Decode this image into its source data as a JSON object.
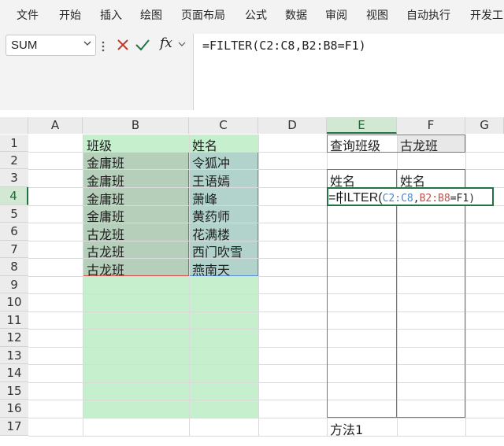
{
  "ribbon": {
    "tabs": [
      "文件",
      "开始",
      "插入",
      "绘图",
      "页面布局",
      "公式",
      "数据",
      "审阅",
      "视图",
      "自动执行",
      "开发工"
    ]
  },
  "formula_bar": {
    "name_box": "SUM",
    "fx_label": "fx",
    "formula": "=FILTER(C2:C8,B2:B8=F1)"
  },
  "columns": [
    "A",
    "B",
    "C",
    "D",
    "E",
    "F",
    "G"
  ],
  "rows": [
    "1",
    "2",
    "3",
    "4",
    "5",
    "6",
    "7",
    "8",
    "9",
    "10",
    "11",
    "12",
    "13",
    "14",
    "15",
    "16",
    "17"
  ],
  "active_column": "E",
  "active_row": "4",
  "cells": {
    "B1": "班级",
    "C1": "姓名",
    "B2": "金庸班",
    "C2": "令狐冲",
    "B3": "金庸班",
    "C3": "王语嫣",
    "B4": "金庸班",
    "C4": "萧峰",
    "B5": "金庸班",
    "C5": "黄药师",
    "B6": "古龙班",
    "C6": "花满楼",
    "B7": "古龙班",
    "C7": "西门吹雪",
    "B8": "古龙班",
    "C8": "燕南天",
    "E1": "查询班级",
    "F1": "古龙班",
    "E3": "姓名",
    "F3": "姓名",
    "E17": "方法1"
  },
  "editor": {
    "prefix": "=FILTER(",
    "range1": "C2:C8",
    "comma": ",",
    "range2": "B2:B8",
    "suffix": "=F1)"
  },
  "colors": {
    "accent_green": "#217346",
    "fill_green": "#c6efce",
    "ref_blue": "#4a86c8",
    "ref_red": "#c0504d"
  },
  "icons": [
    "chevron-down-icon",
    "more-vertical-icon",
    "cancel-icon",
    "enter-check-icon",
    "function-icon"
  ]
}
